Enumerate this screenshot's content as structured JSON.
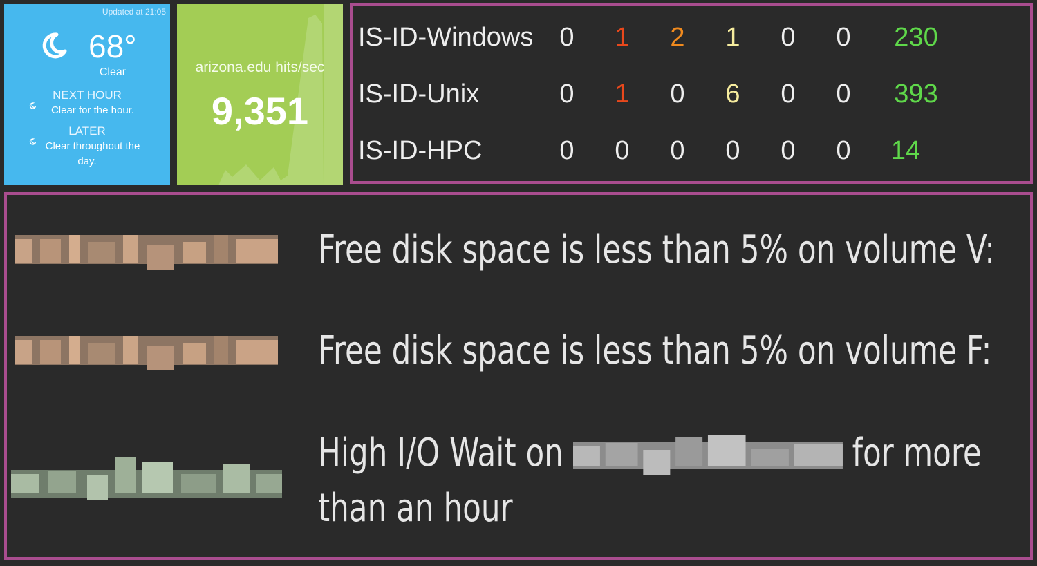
{
  "weather": {
    "updated": "Updated at 21:05",
    "temperature": "68°",
    "condition": "Clear",
    "next_hour_label": "NEXT HOUR",
    "next_hour_text": "Clear for the hour.",
    "later_label": "LATER",
    "later_text_1": "Clear throughout the",
    "later_text_2": "day.",
    "icon": "crescent-moon-icon"
  },
  "hits": {
    "title": "arizona.edu hits/sec",
    "value": "9,351"
  },
  "servers": {
    "rows": [
      {
        "name": "IS-ID-Windows",
        "c1": "0",
        "c2": "1",
        "c3": "2",
        "c4": "1",
        "c5": "0",
        "c6": "0",
        "total": "230"
      },
      {
        "name": "IS-ID-Unix",
        "c1": "0",
        "c2": "1",
        "c3": "0",
        "c4": "6",
        "c5": "0",
        "c6": "0",
        "total": "393"
      },
      {
        "name": "IS-ID-HPC",
        "c1": "0",
        "c2": "0",
        "c3": "0",
        "c4": "0",
        "c5": "0",
        "c6": "0",
        "total": "14"
      }
    ]
  },
  "alerts": {
    "items": [
      {
        "text": "Free disk space is less than 5% on volume V:"
      },
      {
        "text": "Free disk space is less than 5% on volume F:"
      },
      {
        "text_before": "High I/O Wait on",
        "text_after": "for more",
        "text_line2": "than an hour"
      }
    ]
  },
  "colors": {
    "accent_border": "#a94d8f",
    "weather_bg": "#46b8ee",
    "hits_bg": "#a3cd55",
    "critical": "#e8481c",
    "high": "#f08a1e",
    "warning": "#f6ec9e",
    "ok": "#5fd84a",
    "normal": "#eeeeee"
  }
}
